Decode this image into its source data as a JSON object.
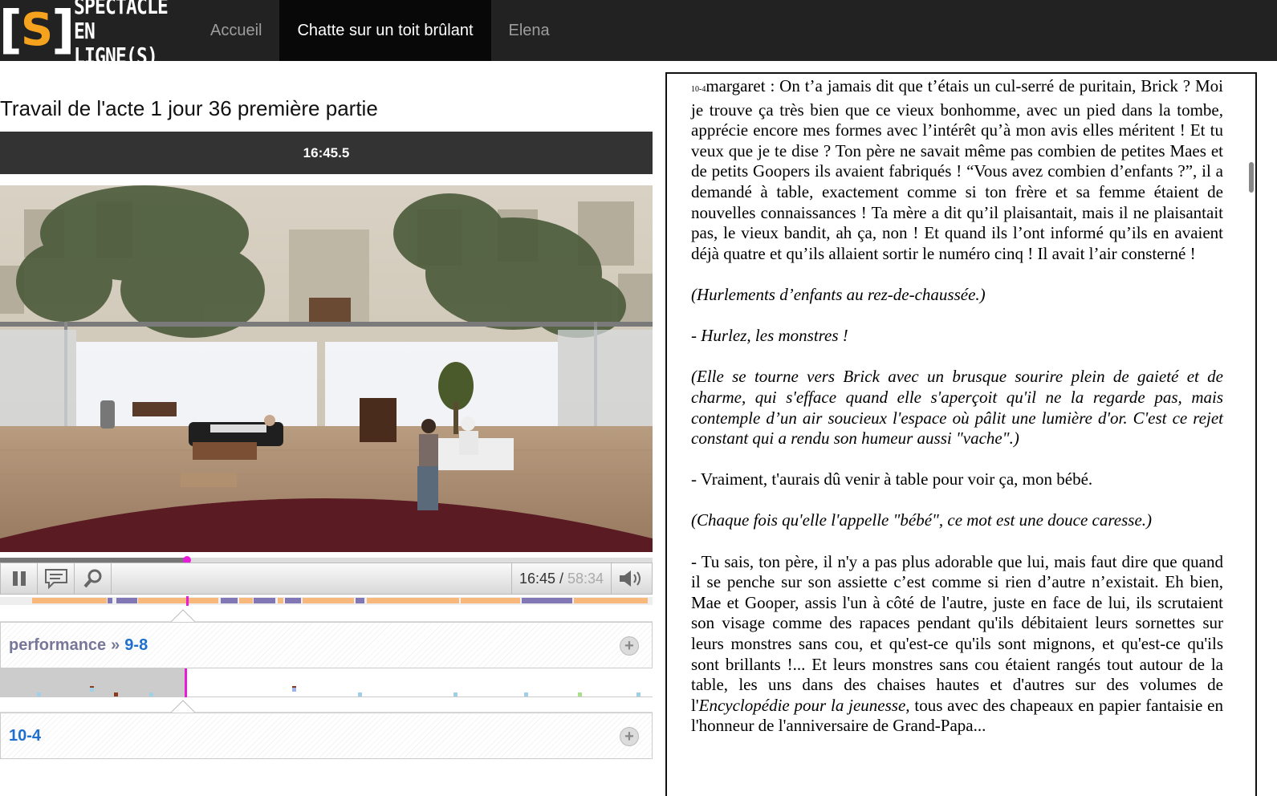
{
  "navbar": {
    "logo_mark": "S",
    "logo_line1": "SPECTACLE",
    "logo_line2": "EN LIGNE(S)",
    "items": [
      {
        "label": "Accueil",
        "active": false
      },
      {
        "label": "Chatte sur un toit brûlant",
        "active": true
      },
      {
        "label": "Elena",
        "active": false
      }
    ]
  },
  "session": {
    "title": "Travail de l'acte 1 jour 36 première partie",
    "timecode": "16:45.5"
  },
  "player": {
    "current_time": "16:45",
    "separator": " / ",
    "total_time": "58:34",
    "progress": 0.286,
    "pause_icon": "pause-icon",
    "comment_icon": "comment-icon",
    "search_icon": "search-icon",
    "volume_icon": "volume-icon"
  },
  "segments": {
    "colors": {
      "orange": "#f8b77b",
      "purple": "#8177b5"
    },
    "items": [
      {
        "start": 0.049,
        "end": 0.163,
        "color": "orange"
      },
      {
        "start": 0.165,
        "end": 0.172,
        "color": "purple"
      },
      {
        "start": 0.178,
        "end": 0.21,
        "color": "purple"
      },
      {
        "start": 0.212,
        "end": 0.335,
        "color": "orange"
      },
      {
        "start": 0.338,
        "end": 0.364,
        "color": "purple"
      },
      {
        "start": 0.367,
        "end": 0.387,
        "color": "orange"
      },
      {
        "start": 0.389,
        "end": 0.422,
        "color": "purple"
      },
      {
        "start": 0.425,
        "end": 0.434,
        "color": "orange"
      },
      {
        "start": 0.437,
        "end": 0.461,
        "color": "purple"
      },
      {
        "start": 0.464,
        "end": 0.543,
        "color": "orange"
      },
      {
        "start": 0.545,
        "end": 0.559,
        "color": "purple"
      },
      {
        "start": 0.562,
        "end": 0.703,
        "color": "orange"
      },
      {
        "start": 0.706,
        "end": 0.797,
        "color": "orange"
      },
      {
        "start": 0.8,
        "end": 0.877,
        "color": "purple"
      },
      {
        "start": 0.88,
        "end": 0.993,
        "color": "orange"
      }
    ]
  },
  "annotations": {
    "category": "performance",
    "separator": "»",
    "category_value": "9-8",
    "current_line": "10-4",
    "ticks": [
      {
        "pos": 0.057,
        "color": "#9fd0e8"
      },
      {
        "pos": 0.138,
        "color": "#8b3a1e"
      },
      {
        "pos": 0.138,
        "color": "#9fd0e8",
        "low": true
      },
      {
        "pos": 0.175,
        "color": "#8b3a1e",
        "low": true
      },
      {
        "pos": 0.229,
        "color": "#9fd0e8"
      },
      {
        "pos": 0.448,
        "color": "#8b3a1e"
      },
      {
        "pos": 0.448,
        "color": "#9fb4e8",
        "low": true
      },
      {
        "pos": 0.549,
        "color": "#9fd0e8"
      },
      {
        "pos": 0.695,
        "color": "#9fd0e8"
      },
      {
        "pos": 0.803,
        "color": "#9fd0e8"
      },
      {
        "pos": 0.885,
        "color": "#a8e08a"
      },
      {
        "pos": 0.975,
        "color": "#9fd0e8"
      }
    ]
  },
  "script": {
    "line_ref": "10-4",
    "paragraphs": [
      {
        "italic": false,
        "text": "margaret : On t’a jamais dit que t’étais un cul-serré de puritain, Brick ? Moi je trouve ça très bien que ce vieux bonhomme, avec un pied dans la tombe, apprécie encore mes formes avec l’intérêt qu’à mon avis elles méritent ! Et tu veux que je te dise ? Ton père ne savait même pas combien de petites Maes et de petits Goopers ils avaient fabriqués ! “Vous avez combien d’enfants ?”, il a demandé à table, exactement comme si ton frère et sa femme étaient de nouvelles connaissances ! Ta mère a dit qu’il plaisantait, mais il ne plaisantait pas, le vieux bandit, ah ça, non ! Et quand ils l’ont informé qu’ils en avaient déjà quatre et qu’ils allaient sortir le numéro cinq ! Il avait l’air consterné !"
      },
      {
        "italic": true,
        "text": "(Hurlements d’enfants au rez-de-chaussée.)"
      },
      {
        "italic": true,
        "text": "- Hurlez, les monstres !"
      },
      {
        "italic": true,
        "text": "(Elle se tourne vers Brick avec un brusque sourire plein de gaieté et de charme, qui s'efface quand elle s'aperçoit qu'il ne la regarde pas, mais contemple d’un air soucieux l'espace où pâlit une lumière d'or. C'est ce rejet constant qui a rendu son humeur aussi \"vache\".)"
      },
      {
        "italic": false,
        "text": "- Vraiment, t'aurais dû venir à table pour voir ça, mon bébé."
      },
      {
        "italic": true,
        "text": "(Chaque fois qu'elle l'appelle \"bébé\", ce mot est une douce caresse.)"
      }
    ],
    "last_paragraph": {
      "part1": "- Tu sais, ton père, il n'y a pas plus adorable que lui, mais faut dire que quand il se penche sur son assiette c’est comme si rien d’autre n’existait. Eh bien, Mae et Gooper, assis l'un à côté de l'autre, juste en face de lui, ils scrutaient son visage comme des rapaces pendant qu'ils débitaient leurs sornettes sur leurs monstres sans cou, et qu'est-ce qu'ils sont mignons, et qu'est-ce qu'ils sont brillants !... Et leurs monstres sans cou étaient rangés tout autour de la table, les uns dans des chaises hautes et d'autres sur des volumes de l'",
      "italic": "Encyclopédie pour la jeunesse,",
      "part2": " tous avec des chapeaux en papier fantaisie en l'honneur de l'anniversaire de Grand-Papa..."
    }
  }
}
